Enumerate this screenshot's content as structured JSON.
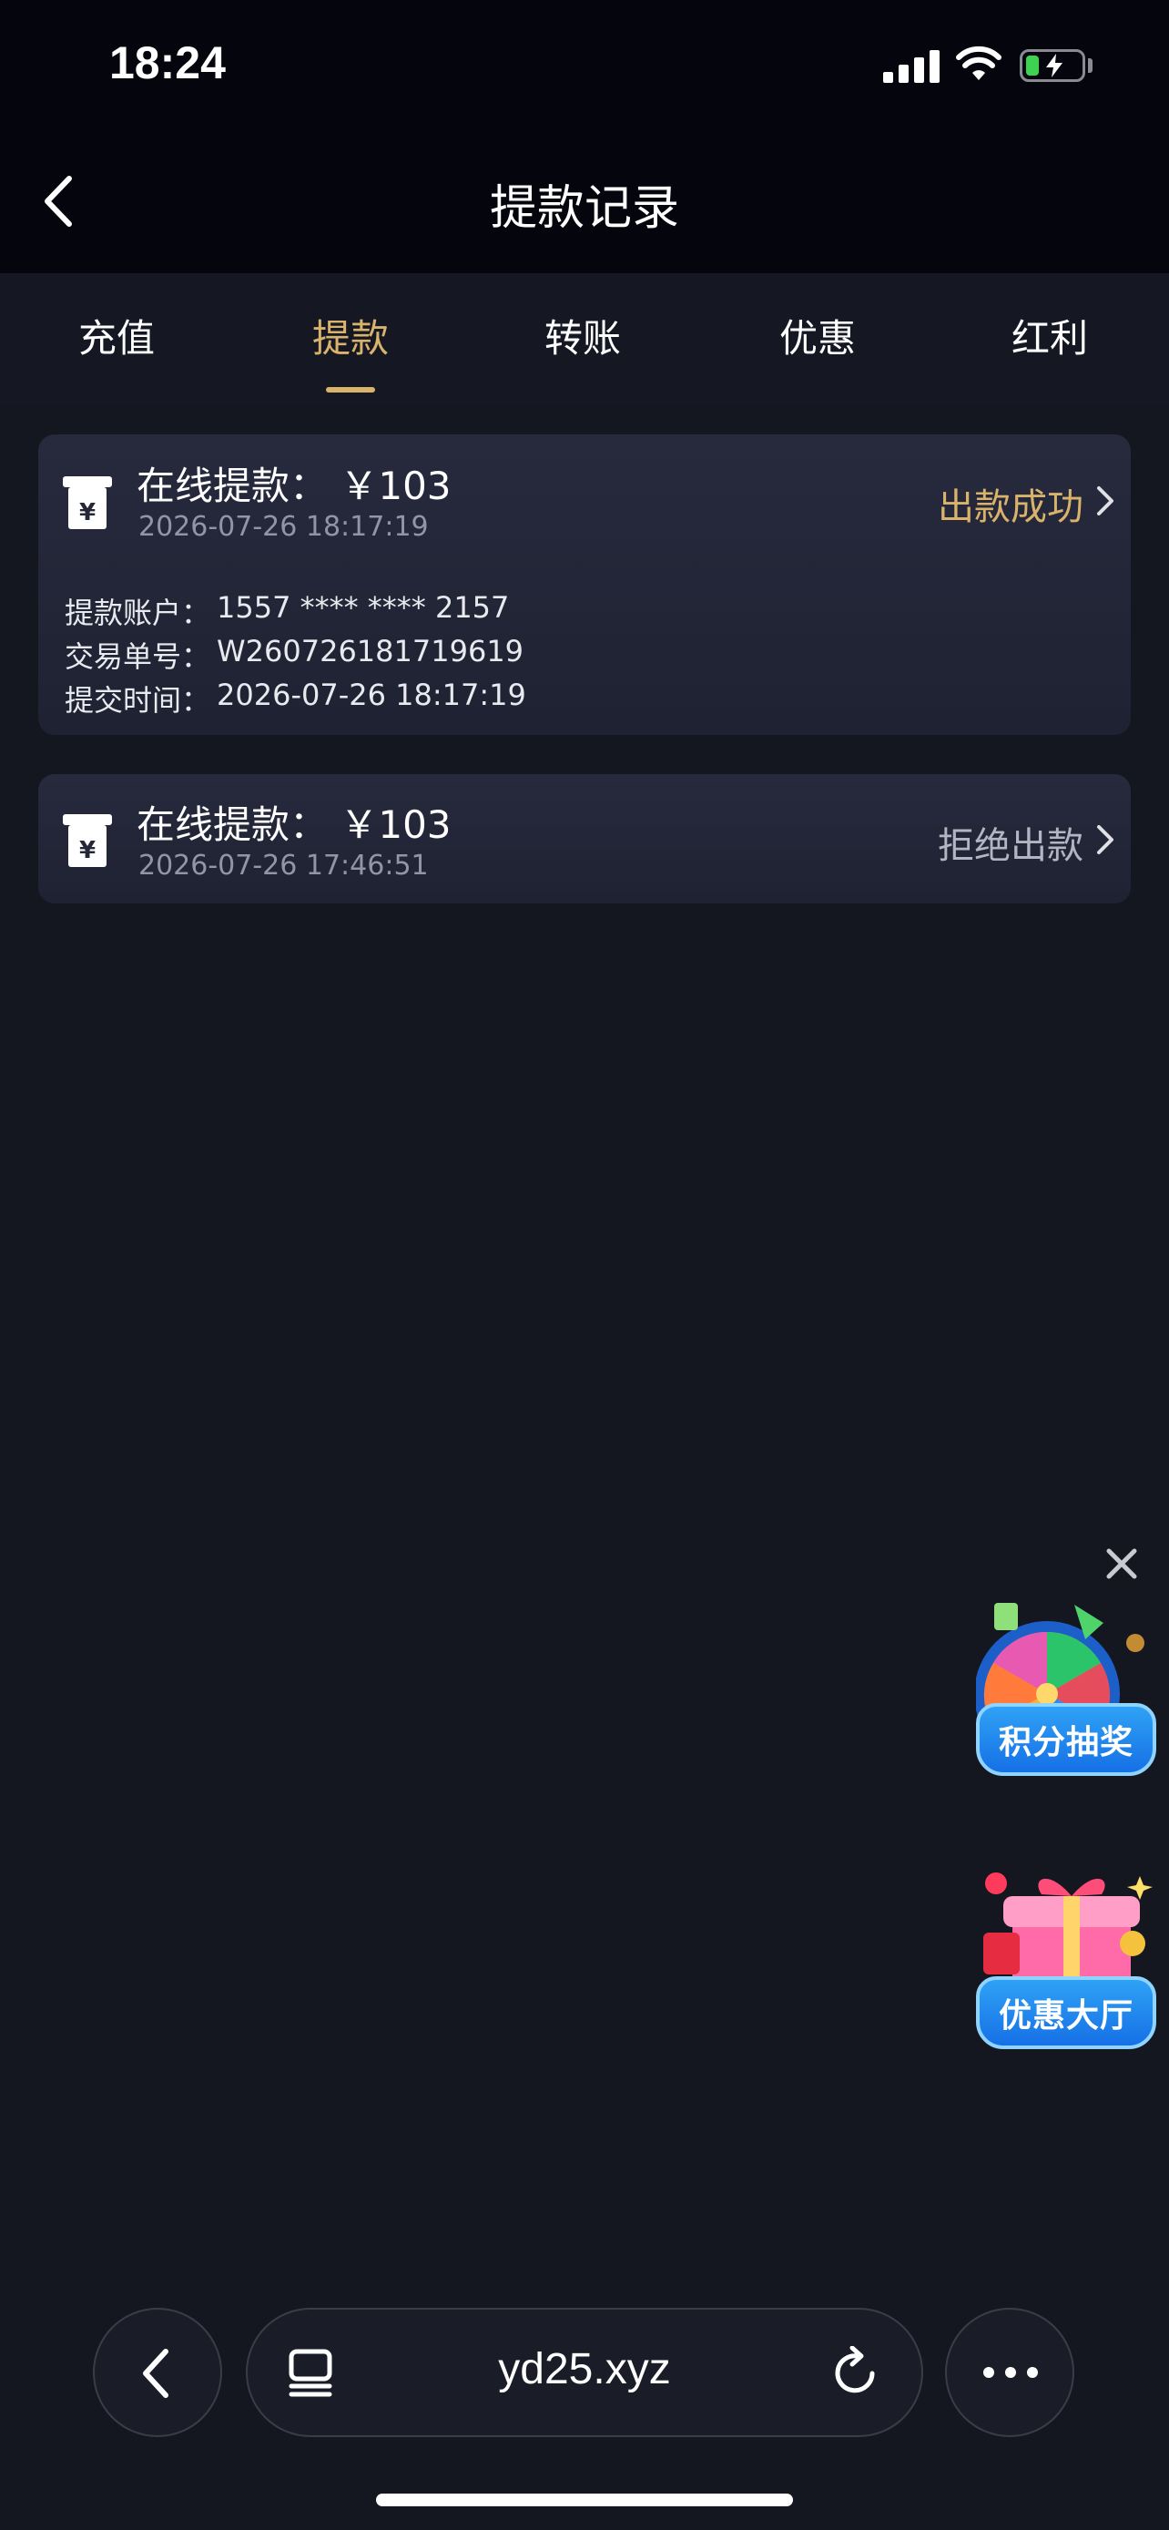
{
  "status_bar": {
    "time": "18:24"
  },
  "header": {
    "title": "提款记录"
  },
  "tabs": [
    {
      "label": "充值",
      "active": false
    },
    {
      "label": "提款",
      "active": true
    },
    {
      "label": "转账",
      "active": false
    },
    {
      "label": "优惠",
      "active": false
    },
    {
      "label": "红利",
      "active": false
    }
  ],
  "records": [
    {
      "title": "在线提款： ￥103",
      "time": "2026-07-26 18:17:19",
      "status": "出款成功",
      "status_color": "#d9b36c",
      "expanded": true,
      "details": [
        {
          "label": "提款账户：",
          "value": "1557 **** **** 2157"
        },
        {
          "label": "交易单号：",
          "value": "W260726181719619"
        },
        {
          "label": "提交时间：",
          "value": "2026-07-26 18:17:19"
        }
      ]
    },
    {
      "title": "在线提款： ￥103",
      "time": "2026-07-26 17:46:51",
      "status": "拒绝出款",
      "status_color": "#b3b6c2",
      "expanded": false
    }
  ],
  "promos": [
    {
      "label": "积分抽奖",
      "icon": "prize-wheel-icon"
    },
    {
      "label": "优惠大厅",
      "icon": "gift-box-icon"
    }
  ],
  "browser": {
    "url": "yd25.xyz"
  },
  "colors": {
    "accent": "#d9b36c",
    "background": "#141620",
    "card": "#242738"
  }
}
